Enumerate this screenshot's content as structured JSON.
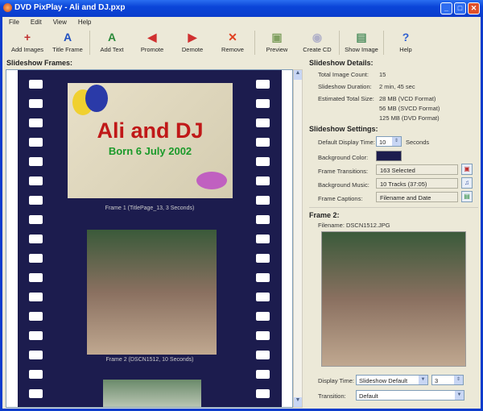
{
  "window": {
    "title": "DVD PixPlay - Ali and DJ.pxp"
  },
  "menu": [
    "File",
    "Edit",
    "View",
    "Help"
  ],
  "toolbar": [
    {
      "label": "Add Images",
      "icon": "add-images-icon",
      "glyph": "+",
      "color": "#c03030"
    },
    {
      "label": "Title Frame",
      "icon": "title-frame-icon",
      "glyph": "A",
      "color": "#2050c0"
    },
    {
      "label": "Add Text",
      "icon": "add-text-icon",
      "glyph": "A",
      "color": "#2a8a3a"
    },
    {
      "label": "Promote",
      "icon": "promote-icon",
      "glyph": "◀",
      "color": "#d03030"
    },
    {
      "label": "Demote",
      "icon": "demote-icon",
      "glyph": "▶",
      "color": "#d03030"
    },
    {
      "label": "Remove",
      "icon": "remove-icon",
      "glyph": "✕",
      "color": "#e04020"
    },
    {
      "label": "Preview",
      "icon": "preview-icon",
      "glyph": "▣",
      "color": "#80a060"
    },
    {
      "label": "Create CD",
      "icon": "create-cd-icon",
      "glyph": "◉",
      "color": "#b0b0c8"
    },
    {
      "label": "Show Image",
      "icon": "show-image-icon",
      "glyph": "▤",
      "color": "#509060"
    },
    {
      "label": "Help",
      "icon": "help-icon",
      "glyph": "?",
      "color": "#3060d0"
    }
  ],
  "frames_panel": {
    "title": "Slideshow Frames:",
    "title_card": {
      "line1": "Ali and DJ",
      "line2": "Born 6 July 2002"
    },
    "captions": [
      "Frame 1  (TitlePage_13, 3 Seconds)",
      "Frame 2  (DSCN1512, 10 Seconds)"
    ]
  },
  "details": {
    "title": "Slideshow Details:",
    "rows": [
      {
        "label": "Total Image Count:",
        "value": "15"
      },
      {
        "label": "Slideshow Duration:",
        "value": "2 min,  45 sec"
      },
      {
        "label": "Estimated Total Size:",
        "value": "28 MB  (VCD Format)"
      }
    ],
    "extra_sizes": [
      "56 MB  (SVCD Format)",
      "125 MB (DVD Format)"
    ]
  },
  "settings": {
    "title": "Slideshow Settings:",
    "display_time_label": "Default Display Time:",
    "display_time": "10",
    "seconds": "Seconds",
    "bg_color_label": "Background Color:",
    "bg_color": "#1c1c4e",
    "transitions_label": "Frame Transitions:",
    "transitions": "163 Selected",
    "music_label": "Background Music:",
    "music": "10 Tracks (37:05)",
    "captions_label": "Frame Captions:",
    "captions": "Filename and Date"
  },
  "frame": {
    "title": "Frame 2:",
    "filename": "Filename: DSCN1512.JPG",
    "display_time_label": "Display Time:",
    "display_time": "Slideshow Default",
    "display_seconds": "3",
    "transition_label": "Transition:",
    "transition": "Default"
  }
}
